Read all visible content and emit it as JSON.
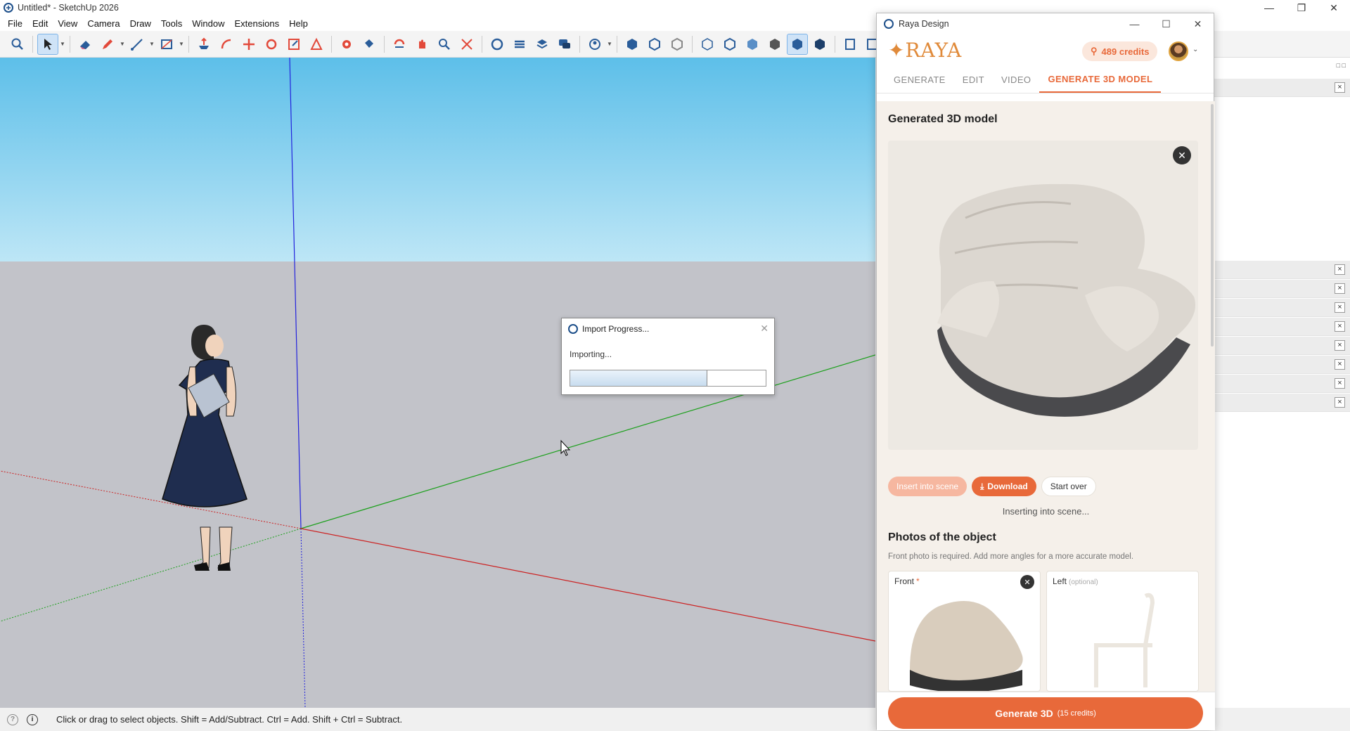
{
  "window": {
    "title": "Untitled* - SketchUp 2026"
  },
  "menu": [
    "File",
    "Edit",
    "View",
    "Camera",
    "Draw",
    "Tools",
    "Window",
    "Extensions",
    "Help"
  ],
  "dialog": {
    "title": "Import Progress...",
    "status": "Importing...",
    "progress": 0.7
  },
  "statusbar": {
    "hint": "Click or drag to select objects. Shift = Add/Subtract. Ctrl = Add. Shift + Ctrl = Subtract."
  },
  "raya": {
    "window_title": "Raya Design",
    "logo": "RAYA",
    "credits": "489 credits",
    "tabs": [
      "GENERATE",
      "EDIT",
      "VIDEO",
      "GENERATE 3D MODEL"
    ],
    "active_tab": "GENERATE 3D MODEL",
    "generated_title": "Generated 3D model",
    "buttons": {
      "insert": "Insert into scene",
      "download": "Download",
      "start_over": "Start over"
    },
    "inserting_status": "Inserting into scene...",
    "photos_title": "Photos of the object",
    "photos_subtitle": "Front photo is required. Add more angles for a more accurate model.",
    "photo_front_label": "Front",
    "photo_front_required": "*",
    "photo_left_label": "Left",
    "photo_left_optional": "(optional)",
    "generate_button": "Generate 3D",
    "generate_cost": "(15 credits)",
    "accent": "#e8693a"
  }
}
